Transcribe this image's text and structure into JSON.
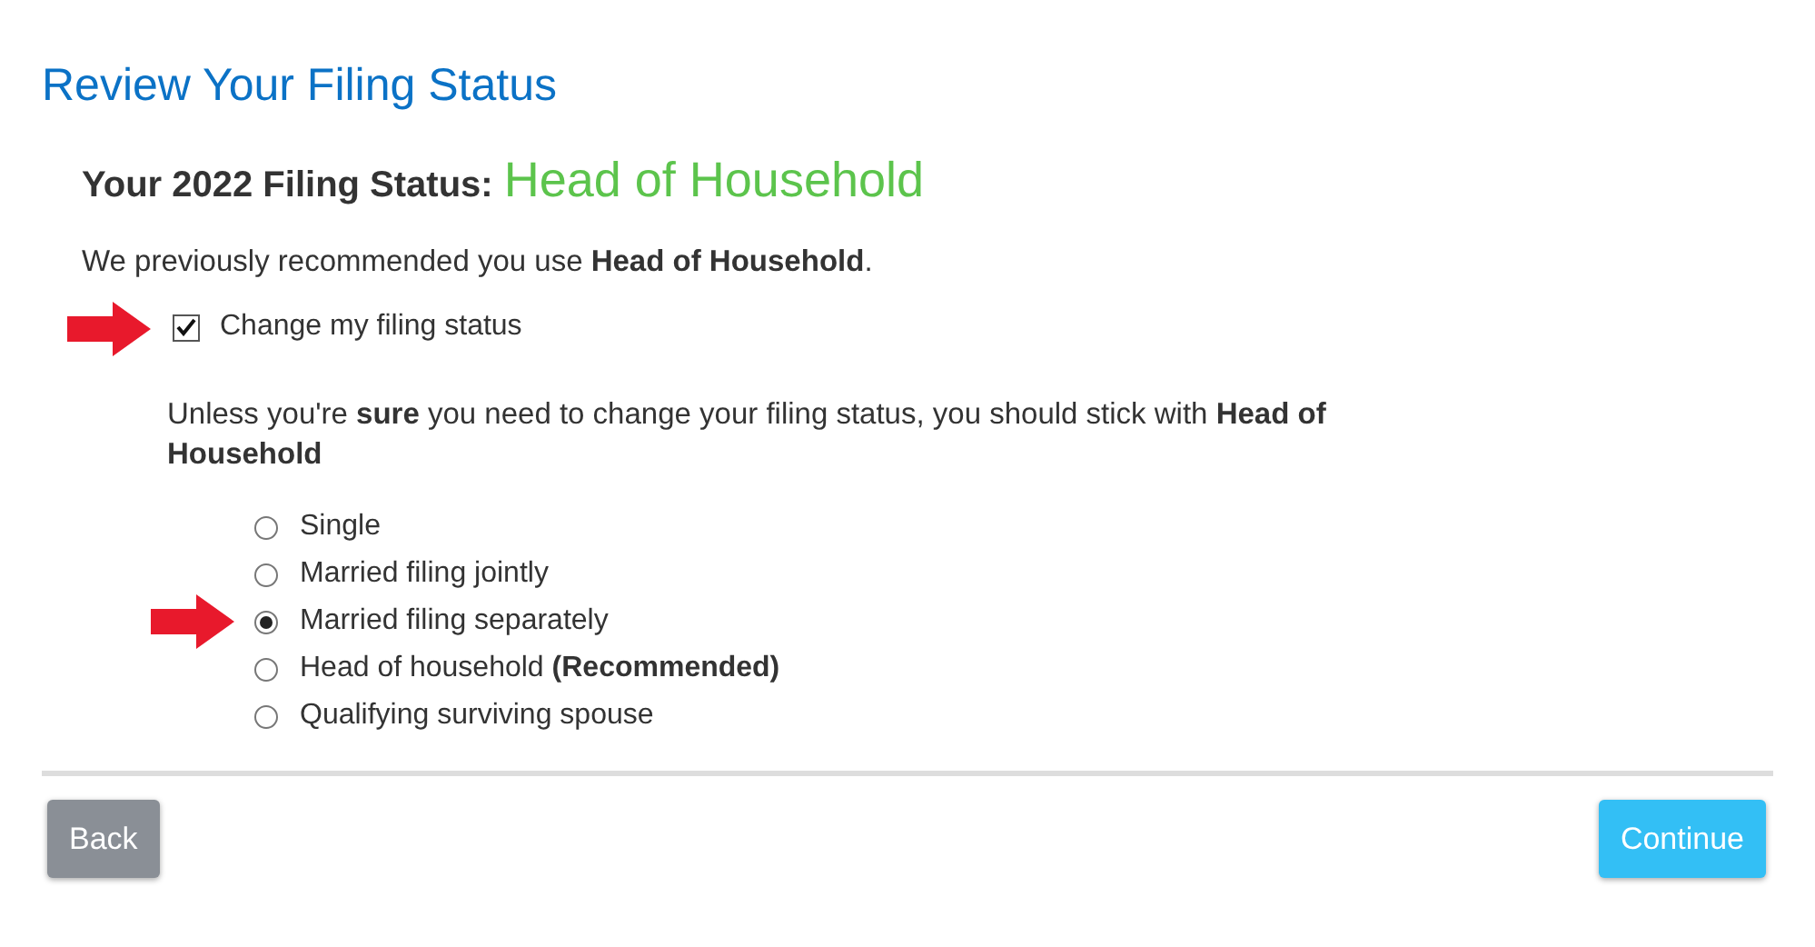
{
  "page": {
    "title": "Review Your Filing Status"
  },
  "status": {
    "label": "Your 2022 Filing Status:",
    "value": "Head of Household"
  },
  "recommendation": "We previously recommended you use **Head of Household**.",
  "change_checkbox": {
    "label": "Change my filing status",
    "checked": true,
    "annotated": true
  },
  "advice": "Unless you're **sure** you need to change your filing status, you should stick with **Head of Household**",
  "options": [
    {
      "label": "Single",
      "selected": false,
      "annotated": false
    },
    {
      "label": "Married filing jointly",
      "selected": false,
      "annotated": false
    },
    {
      "label": "Married filing separately",
      "selected": true,
      "annotated": true
    },
    {
      "label": "Head of household **(Recommended)**",
      "selected": false,
      "annotated": false
    },
    {
      "label": "Qualifying surviving spouse",
      "selected": false,
      "annotated": false
    }
  ],
  "buttons": [
    {
      "label": "Back",
      "kind": "secondary"
    },
    {
      "label": "Continue",
      "kind": "primary"
    }
  ]
}
